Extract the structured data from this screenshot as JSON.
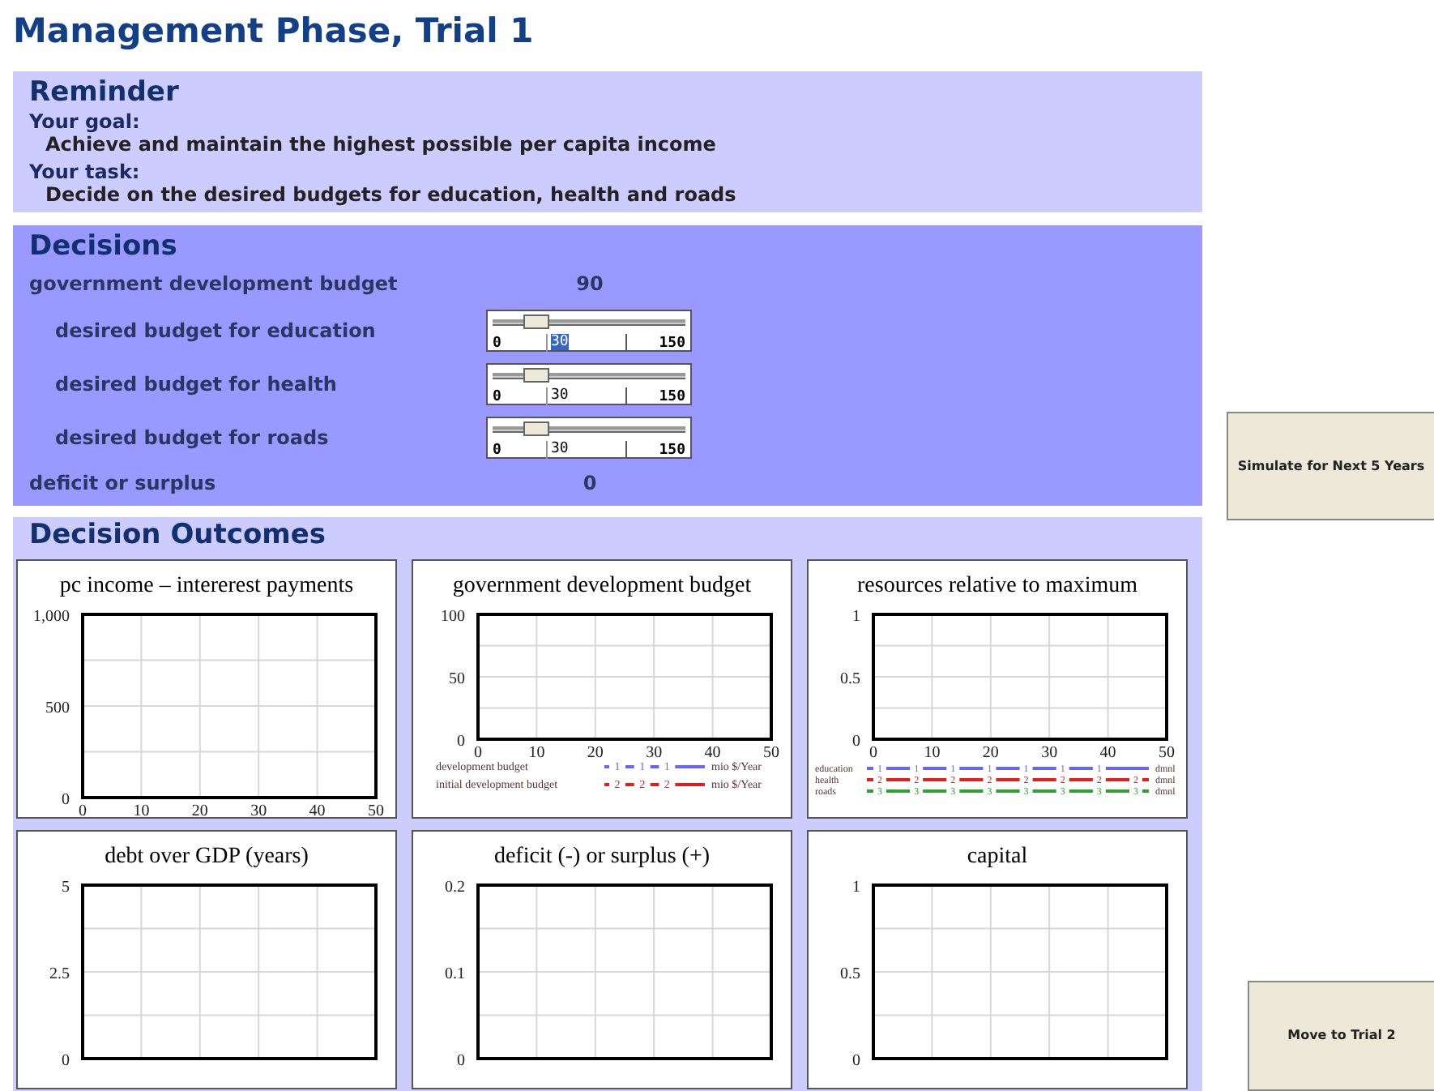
{
  "title": "Management Phase, Trial 1",
  "reminder": {
    "heading": "Reminder",
    "items": [
      {
        "label": "Your goal:",
        "text": "Achieve and maintain the highest possible per capita income"
      },
      {
        "label": "Your task:",
        "text": "Decide on the desired budgets for education, health and roads"
      }
    ]
  },
  "decisions": {
    "heading": "Decisions",
    "rows": [
      {
        "kind": "value",
        "label": "government development budget",
        "value": "90"
      },
      {
        "kind": "slider",
        "label": "desired budget for education",
        "min": "0",
        "max": "150",
        "value": "30",
        "level": 0.2,
        "focused": true
      },
      {
        "kind": "slider",
        "label": "desired budget for health",
        "min": "0",
        "max": "150",
        "value": "30",
        "level": 0.2,
        "focused": false
      },
      {
        "kind": "slider",
        "label": "desired budget for roads",
        "min": "0",
        "max": "150",
        "value": "30",
        "level": 0.2,
        "focused": false
      },
      {
        "kind": "value",
        "label": "deficit or surplus",
        "value": "0"
      }
    ]
  },
  "outcomes": {
    "heading": "Decision Outcomes",
    "charts": [
      {
        "chart_data": {
          "type": "line",
          "title": "pc income – intererest payments",
          "xlim": [
            0,
            50
          ],
          "ylim": [
            0,
            1000
          ],
          "xticks": [
            0,
            10,
            20,
            30,
            40,
            50
          ],
          "yticks": [
            0,
            500,
            {
              "value": 1000,
              "label": "1,000"
            }
          ],
          "grid": true
        }
      },
      {
        "chart_data": {
          "type": "line",
          "title": "government development budget",
          "xlim": [
            0,
            50
          ],
          "ylim": [
            0,
            100
          ],
          "xticks": [
            0,
            10,
            20,
            30,
            40,
            50
          ],
          "yticks": [
            0,
            50,
            100
          ],
          "grid": true
        },
        "legend": [
          {
            "name": "development budget",
            "color": "#6666ff",
            "markers": [
              "1",
              "1",
              "1"
            ],
            "unit": "mio $/Year"
          },
          {
            "name": "initial development budget",
            "color": "#e02020",
            "markers": [
              "2",
              "2",
              "2"
            ],
            "unit": "mio $/Year"
          }
        ]
      },
      {
        "chart_data": {
          "type": "line",
          "title": "resources relative to maximum",
          "xlim": [
            0,
            50
          ],
          "ylim": [
            0,
            1
          ],
          "xticks": [
            0,
            10,
            20,
            30,
            40,
            50
          ],
          "yticks": [
            0,
            0.5,
            1
          ],
          "grid": true
        },
        "legend": [
          {
            "name": "education",
            "color": "#6666ff",
            "markers": [
              "1",
              "1",
              "1",
              "1",
              "1",
              "1",
              "1"
            ],
            "unit": "dmnl"
          },
          {
            "name": "health",
            "color": "#e02020",
            "markers": [
              "2",
              "2",
              "2",
              "2",
              "2",
              "2",
              "2",
              "2"
            ],
            "unit": "dmnl"
          },
          {
            "name": "roads",
            "color": "#30a030",
            "markers": [
              "3",
              "3",
              "3",
              "3",
              "3",
              "3",
              "3",
              "3"
            ],
            "unit": "dmnl"
          }
        ]
      },
      {
        "chart_data": {
          "type": "line",
          "title": "debt over GDP (years)",
          "xlim": [
            0,
            50
          ],
          "ylim": [
            0,
            5
          ],
          "yticks": [
            0,
            2.5,
            5
          ],
          "grid": true
        }
      },
      {
        "chart_data": {
          "type": "line",
          "title": "deficit (-) or surplus (+)",
          "xlim": [
            0,
            50
          ],
          "ylim": [
            0,
            0.2
          ],
          "yticks": [
            0,
            0.1,
            0.2
          ],
          "grid": true
        }
      },
      {
        "chart_data": {
          "type": "line",
          "title": "capital",
          "xlim": [
            0,
            50
          ],
          "ylim": [
            0,
            1
          ],
          "yticks": [
            0,
            0.5,
            1
          ],
          "grid": true
        }
      }
    ]
  },
  "buttons": [
    {
      "label": "Simulate for Next 5 Years"
    },
    {
      "label": "Move to Trial 2"
    }
  ]
}
